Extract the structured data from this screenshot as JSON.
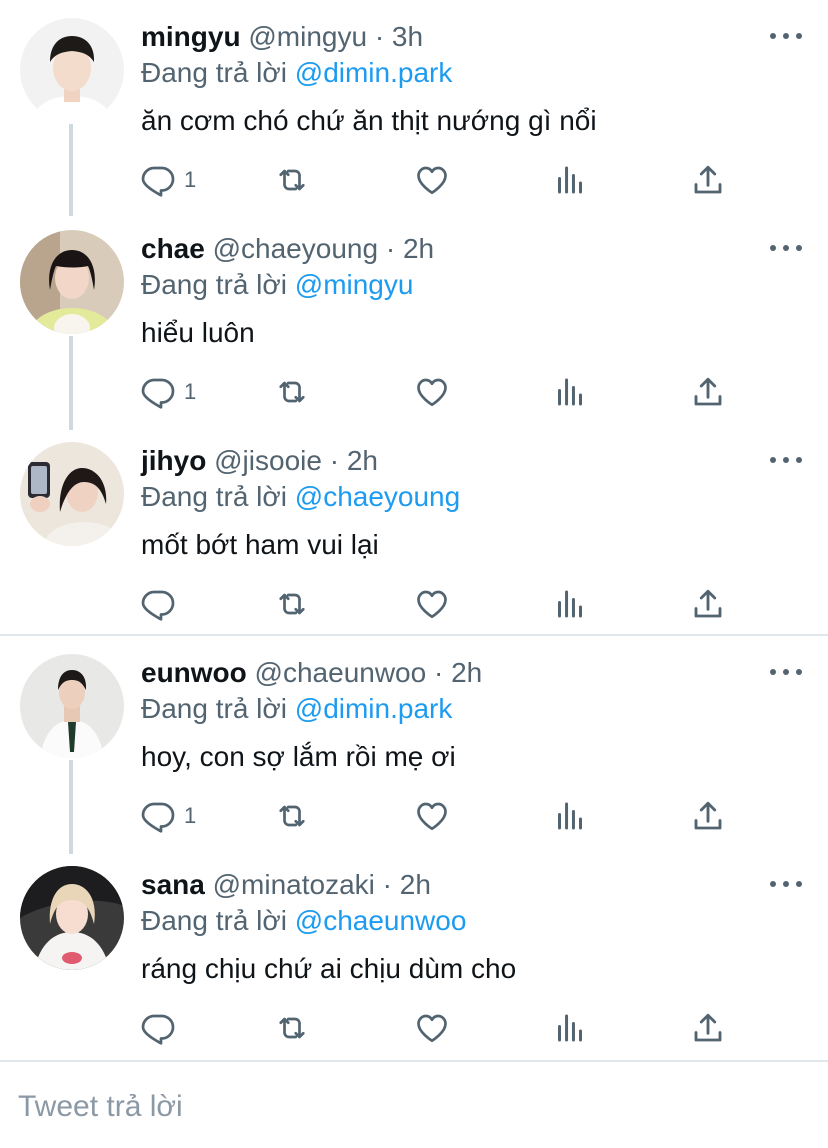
{
  "colors": {
    "text": "#0f1419",
    "secondary": "#536471",
    "link": "#1d9bf0",
    "thread_line": "#cfd9de",
    "divider": "#e1e8ed"
  },
  "tweets": [
    {
      "name": "mingyu",
      "handle": "@mingyu",
      "separator": "·",
      "time": "3h",
      "reply_prefix": "Đang trả lời",
      "reply_to": "@dimin.park",
      "text": "ăn cơm chó chứ ăn thịt nướng gì nổi",
      "reply_count": "1",
      "icons": [
        "reply-icon",
        "retweet-icon",
        "like-icon",
        "stats-icon",
        "share-icon",
        "more-icon"
      ]
    },
    {
      "name": "chae",
      "handle": "@chaeyoung",
      "separator": "·",
      "time": "2h",
      "reply_prefix": "Đang trả lời",
      "reply_to": "@mingyu",
      "text": "hiểu luôn",
      "reply_count": "1"
    },
    {
      "name": "jihyo",
      "handle": "@jisooie",
      "separator": "·",
      "time": "2h",
      "reply_prefix": "Đang trả lời",
      "reply_to": "@chaeyoung",
      "text": "mốt bớt ham vui lại",
      "reply_count": ""
    },
    {
      "name": "eunwoo",
      "handle": "@chaeunwoo",
      "separator": "·",
      "time": "2h",
      "reply_prefix": "Đang trả lời",
      "reply_to": "@dimin.park",
      "text": "hoy, con sợ lắm rồi mẹ ơi",
      "reply_count": "1"
    },
    {
      "name": "sana",
      "handle": "@minatozaki",
      "separator": "·",
      "time": "2h",
      "reply_prefix": "Đang trả lời",
      "reply_to": "@chaeunwoo",
      "text": "ráng chịu chứ ai chịu dùm cho",
      "reply_count": ""
    }
  ],
  "compose": {
    "placeholder": "Tweet trả lời"
  }
}
